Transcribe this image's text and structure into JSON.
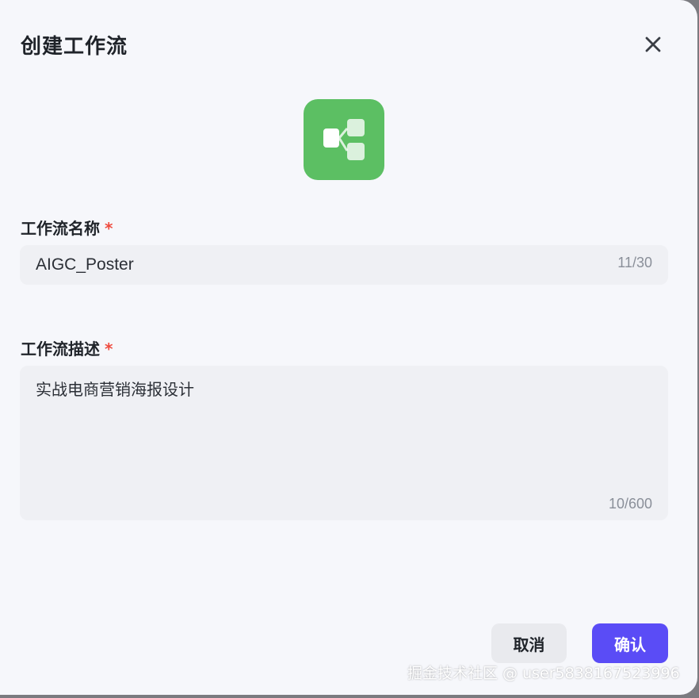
{
  "dialog": {
    "title": "创建工作流",
    "close_icon": "close-icon",
    "app_icon": "workflow-icon",
    "app_icon_color": "#5cbf63"
  },
  "form": {
    "name": {
      "label": "工作流名称",
      "required_mark": "*",
      "value": "AIGC_Poster",
      "counter": "11/30"
    },
    "description": {
      "label": "工作流描述",
      "required_mark": "*",
      "value": "实战电商营销海报设计",
      "counter": "10/600"
    }
  },
  "actions": {
    "cancel_label": "取消",
    "confirm_label": "确认",
    "confirm_color": "#5a4cf6"
  },
  "watermark": "掘金技术社区 @ user5838167523996"
}
